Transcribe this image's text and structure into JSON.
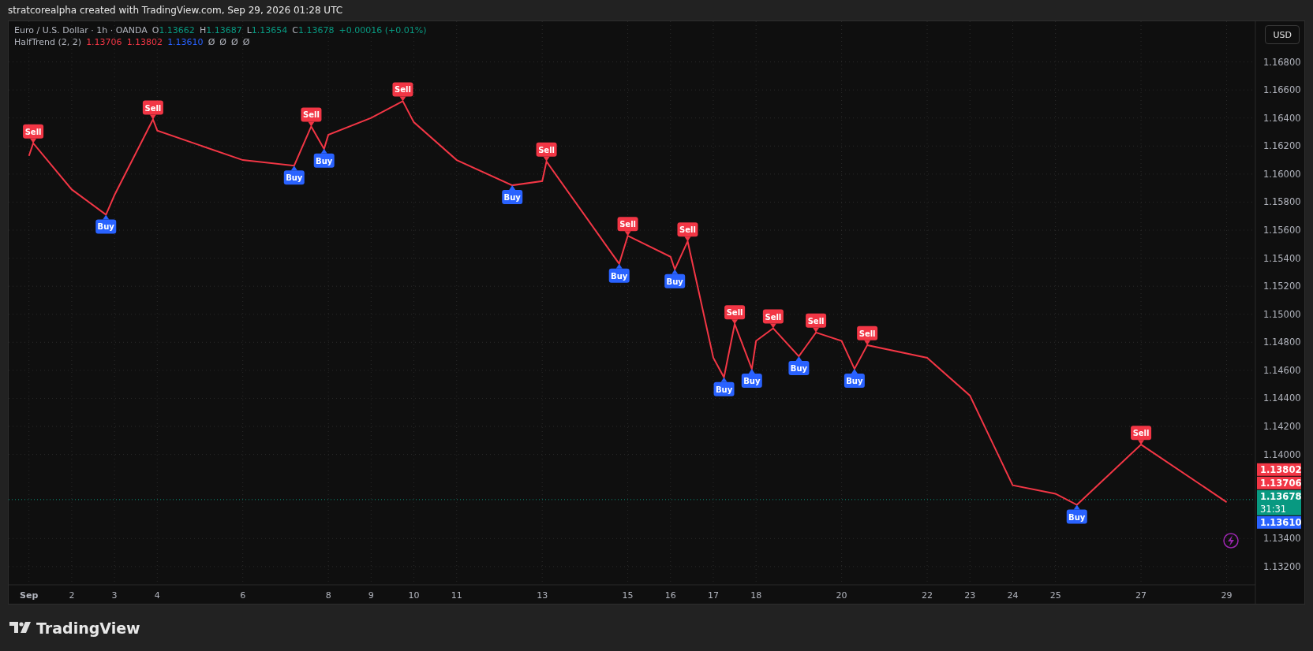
{
  "header": {
    "title": "stratcorealpha created with TradingView.com, Sep 29, 2026 01:28 UTC"
  },
  "legend": {
    "symbol": "Euro / U.S. Dollar · 1h · OANDA",
    "ohlc": [
      {
        "key": "O",
        "value": "1.13662"
      },
      {
        "key": "H",
        "value": "1.13687"
      },
      {
        "key": "L",
        "value": "1.13654"
      },
      {
        "key": "C",
        "value": "1.13678"
      }
    ],
    "change": "+0.00016 (+0.01%)",
    "indicator": "HalfTrend (2, 2)",
    "indicator_values": [
      {
        "text": "1.13706",
        "color": "#f23645"
      },
      {
        "text": "1.13802",
        "color": "#f23645"
      },
      {
        "text": "1.13610",
        "color": "#2962ff"
      },
      {
        "text": "Ø",
        "color": "#b2b5be"
      },
      {
        "text": "Ø",
        "color": "#b2b5be"
      },
      {
        "text": "Ø",
        "color": "#b2b5be"
      },
      {
        "text": "Ø",
        "color": "#b2b5be"
      }
    ]
  },
  "currency_button": "USD",
  "chart": {
    "chart_data": {
      "type": "line",
      "grid": true,
      "x": [
        1,
        1.1,
        2,
        2.8,
        3,
        3.9,
        4,
        6,
        7.2,
        7.6,
        7.9,
        8,
        9,
        9.74,
        10,
        11,
        12.3,
        13,
        13.1,
        14.8,
        15,
        16,
        16.1,
        16.4,
        17,
        17.25,
        17.5,
        17.9,
        18,
        18.4,
        19,
        19.4,
        20,
        20.3,
        20.6,
        22,
        23,
        24,
        25,
        25.5,
        27,
        29
      ],
      "series": [
        {
          "color": "#f23645",
          "values": [
            1.1613,
            1.1622,
            1.1589,
            1.1571,
            1.1585,
            1.1639,
            1.1631,
            1.161,
            1.1606,
            1.1634,
            1.1618,
            1.1628,
            1.164,
            1.1652,
            1.1637,
            1.161,
            1.1592,
            1.1595,
            1.1609,
            1.1536,
            1.1556,
            1.1541,
            1.1532,
            1.1552,
            1.1469,
            1.1455,
            1.1493,
            1.1461,
            1.1481,
            1.149,
            1.147,
            1.1487,
            1.1481,
            1.1461,
            1.1478,
            1.1469,
            1.1442,
            1.1378,
            1.1372,
            1.1364,
            1.1407,
            1.1366
          ]
        }
      ],
      "xlim": [
        0.6,
        29.6
      ],
      "ylim": [
        1.1307,
        1.1709
      ],
      "xticks": [
        {
          "value": 1,
          "label": "Sep"
        },
        2,
        3,
        4,
        6,
        8,
        9,
        10,
        11,
        13,
        15,
        16,
        17,
        18,
        20,
        22,
        23,
        24,
        25,
        27,
        29
      ],
      "yticks": [
        {
          "value": 1.168,
          "label": "1.16800"
        },
        {
          "value": 1.166,
          "label": "1.16600"
        },
        {
          "value": 1.164,
          "label": "1.16400"
        },
        {
          "value": 1.162,
          "label": "1.16200"
        },
        {
          "value": 1.16,
          "label": "1.16000"
        },
        {
          "value": 1.158,
          "label": "1.15800"
        },
        {
          "value": 1.156,
          "label": "1.15600"
        },
        {
          "value": 1.154,
          "label": "1.15400"
        },
        {
          "value": 1.152,
          "label": "1.15200"
        },
        {
          "value": 1.15,
          "label": "1.15000"
        },
        {
          "value": 1.148,
          "label": "1.14800"
        },
        {
          "value": 1.146,
          "label": "1.14600"
        },
        {
          "value": 1.144,
          "label": "1.14400"
        },
        {
          "value": 1.142,
          "label": "1.14200"
        },
        {
          "value": 1.14,
          "label": "1.14000"
        },
        {
          "value": 1.134,
          "label": "1.13400"
        },
        {
          "value": 1.132,
          "label": "1.13200"
        }
      ],
      "ref_lines": [
        {
          "axis": "y",
          "value": 1.13678,
          "label": "1.13678",
          "color": "#089981"
        }
      ],
      "annotations": [
        {
          "x": 1.1,
          "y": 1.1622,
          "text": "Sell"
        },
        {
          "x": 3.9,
          "y": 1.1639,
          "text": "Sell"
        },
        {
          "x": 7.6,
          "y": 1.1634,
          "text": "Sell"
        },
        {
          "x": 9.74,
          "y": 1.1652,
          "text": "Sell"
        },
        {
          "x": 13.1,
          "y": 1.1609,
          "text": "Sell"
        },
        {
          "x": 15,
          "y": 1.1556,
          "text": "Sell"
        },
        {
          "x": 16.4,
          "y": 1.1552,
          "text": "Sell"
        },
        {
          "x": 17.5,
          "y": 1.1493,
          "text": "Sell"
        },
        {
          "x": 18.4,
          "y": 1.149,
          "text": "Sell"
        },
        {
          "x": 19.4,
          "y": 1.1487,
          "text": "Sell"
        },
        {
          "x": 20.6,
          "y": 1.1478,
          "text": "Sell"
        },
        {
          "x": 27,
          "y": 1.1407,
          "text": "Sell"
        },
        {
          "x": 2.8,
          "y": 1.1571,
          "text": "Buy"
        },
        {
          "x": 7.2,
          "y": 1.1606,
          "text": "Buy"
        },
        {
          "x": 7.9,
          "y": 1.1618,
          "text": "Buy"
        },
        {
          "x": 12.3,
          "y": 1.1592,
          "text": "Buy"
        },
        {
          "x": 14.8,
          "y": 1.1536,
          "text": "Buy"
        },
        {
          "x": 16.1,
          "y": 1.1532,
          "text": "Buy"
        },
        {
          "x": 17.25,
          "y": 1.1455,
          "text": "Buy"
        },
        {
          "x": 17.9,
          "y": 1.1461,
          "text": "Buy"
        },
        {
          "x": 19,
          "y": 1.147,
          "text": "Buy"
        },
        {
          "x": 20.3,
          "y": 1.1461,
          "text": "Buy"
        },
        {
          "x": 25.5,
          "y": 1.1364,
          "text": "Buy"
        }
      ]
    },
    "price_badges": [
      {
        "text": "1.13802",
        "color": "#f23645"
      },
      {
        "text": "1.13706",
        "color": "#f23645"
      },
      {
        "countdown": "31:31",
        "color": "#089981"
      },
      {
        "text": "1.13610",
        "color": "#2962ff"
      }
    ]
  },
  "footer": {
    "brand": "TradingView"
  }
}
